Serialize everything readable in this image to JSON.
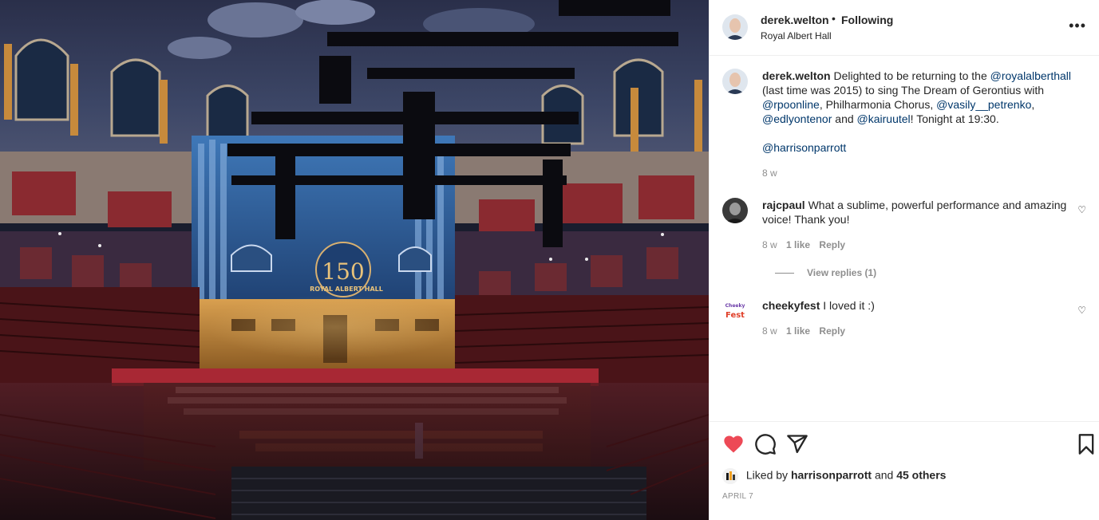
{
  "post": {
    "author": "derek.welton",
    "dot": "•",
    "follow_status": "Following",
    "location": "Royal Albert Hall",
    "more": "•••"
  },
  "photo": {
    "sign_number": "150",
    "sign_text": "ROYAL ALBERT HALL"
  },
  "caption": {
    "username": "derek.welton",
    "t1": "Delighted to be returning to the",
    "m1": "@royalalberthall",
    "t2": "(last time was 2015) to sing The Dream of Gerontius with",
    "m2": "@rpoonline",
    "t3": ", Philharmonia Chorus,",
    "m3": "@vasily__petrenko",
    "t4": ",",
    "m4": "@edlyontenor",
    "t5": "and",
    "m5": "@kairuutel",
    "t6": "! Tonight at 19:30.",
    "m6": "@harrisonparrott",
    "time": "8 w"
  },
  "comments": [
    {
      "username": "rajcpaul",
      "text": "What a sublime, powerful performance and amazing voice! Thank you!",
      "time": "8 w",
      "likes": "1 like",
      "reply": "Reply",
      "view_replies": "View replies (1)"
    },
    {
      "username": "cheekyfest",
      "text": "I loved it :)",
      "time": "8 w",
      "likes": "1 like",
      "reply": "Reply",
      "avatar_text_1": "Cheeky",
      "avatar_text_2": "Fest"
    }
  ],
  "likes": {
    "prefix": "Liked by",
    "user": "harrisonparrott",
    "and": "and",
    "others": "45 others"
  },
  "date": "APRIL 7",
  "colors": {
    "like_red": "#ed4956",
    "mention_blue": "#00376b",
    "muted": "#8e8e8e"
  },
  "icons": [
    "heart-icon",
    "comment-icon",
    "share-icon",
    "bookmark-icon",
    "more-icon"
  ]
}
